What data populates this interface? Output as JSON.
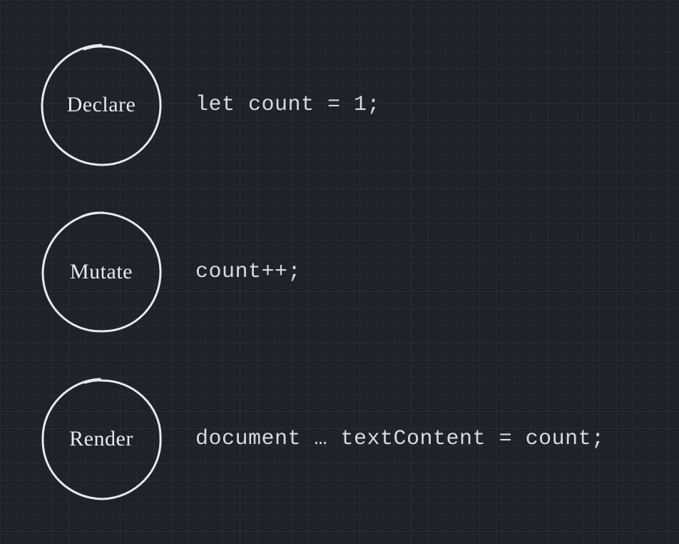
{
  "rows": [
    {
      "label": "Declare",
      "code": "let count = 1;"
    },
    {
      "label": "Mutate",
      "code": "count++;"
    },
    {
      "label": "Render",
      "code": "document … textContent = count;"
    }
  ]
}
